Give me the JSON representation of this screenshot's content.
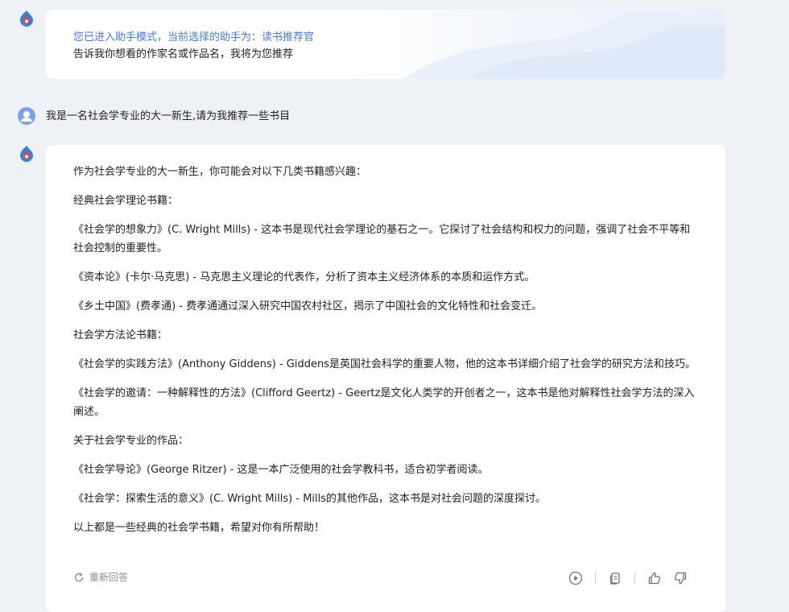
{
  "assistant_intro": {
    "mode_notice": "您已进入助手模式，当前选择的助手为：读书推荐官",
    "prompt": "告诉我你想看的作家名或作品名，我将为您推荐"
  },
  "user_message": "我是一名社会学专业的大一新生,请为我推荐一些书目",
  "answer": {
    "paragraphs": [
      "作为社会学专业的大一新生，你可能会对以下几类书籍感兴趣：",
      "经典社会学理论书籍：",
      "《社会学的想象力》(C. Wright Mills) - 这本书是现代社会学理论的基石之一。它探讨了社会结构和权力的问题，强调了社会不平等和社会控制的重要性。",
      "《资本论》(卡尔·马克思) - 马克思主义理论的代表作，分析了资本主义经济体系的本质和运作方式。",
      "《乡土中国》(费孝通) - 费孝通通过深入研究中国农村社区，揭示了中国社会的文化特性和社会变迁。",
      "社会学方法论书籍：",
      "《社会学的实践方法》(Anthony Giddens) - Giddens是英国社会科学的重要人物，他的这本书详细介绍了社会学的研究方法和技巧。",
      "《社会学的邀请：一种解释性的方法》(Clifford Geertz) - Geertz是文化人类学的开创者之一，这本书是他对解释性社会学方法的深入阐述。",
      "关于社会学专业的作品：",
      "《社会学导论》(George Ritzer) - 这是一本广泛使用的社会学教科书，适合初学者阅读。",
      "《社会学：探索生活的意义》(C. Wright Mills) - Mills的其他作品，这本书是对社会问题的深度探讨。",
      "以上都是一些经典的社会学书籍，希望对你有所帮助！"
    ]
  },
  "footer": {
    "regenerate_label": "重新回答"
  },
  "icons": {
    "bot_avatar": "flame-logo-icon",
    "user_avatar": "user-avatar-icon",
    "regenerate": "refresh-icon",
    "play": "play-icon",
    "copy": "copy-icon",
    "like": "thumbs-up-icon",
    "dislike": "thumbs-down-icon"
  },
  "colors": {
    "background": "#eef1f6",
    "card": "#ffffff",
    "accent_blue": "#4a7bdc",
    "muted": "#8a8f99",
    "logo_red": "#e8433a",
    "logo_blue": "#2f80ed"
  }
}
